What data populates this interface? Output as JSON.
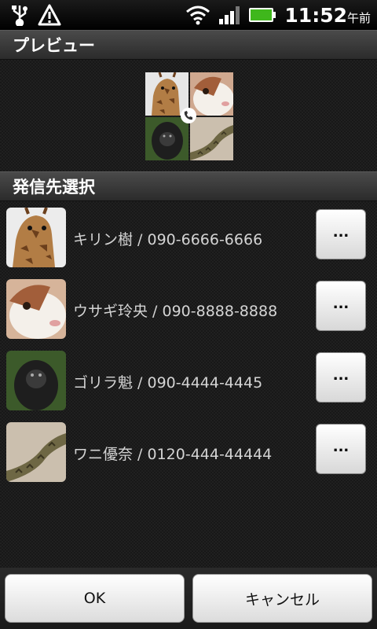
{
  "status_bar": {
    "time": "11:52",
    "ampm": "午前",
    "icons": [
      "usb-icon",
      "warning-icon",
      "wifi-icon",
      "signal-icon",
      "battery-icon"
    ]
  },
  "preview": {
    "header": "プレビュー"
  },
  "select": {
    "header": "発信先選択"
  },
  "contacts": [
    {
      "label": "キリン樹 / 090-6666-6666",
      "more": "...",
      "photo": "giraffe"
    },
    {
      "label": "ウサギ玲央 / 090-8888-8888",
      "more": "...",
      "photo": "rabbit"
    },
    {
      "label": "ゴリラ魁 / 090-4444-4445",
      "more": "...",
      "photo": "gorilla"
    },
    {
      "label": "ワニ優奈 / 0120-444-44444",
      "more": "...",
      "photo": "lizard"
    }
  ],
  "buttons": {
    "ok": "OK",
    "cancel": "キャンセル"
  },
  "colors": {
    "header_bg": "#3c3c3c",
    "button_bg": "#f0f0f0",
    "text": "#d4d4d4"
  }
}
